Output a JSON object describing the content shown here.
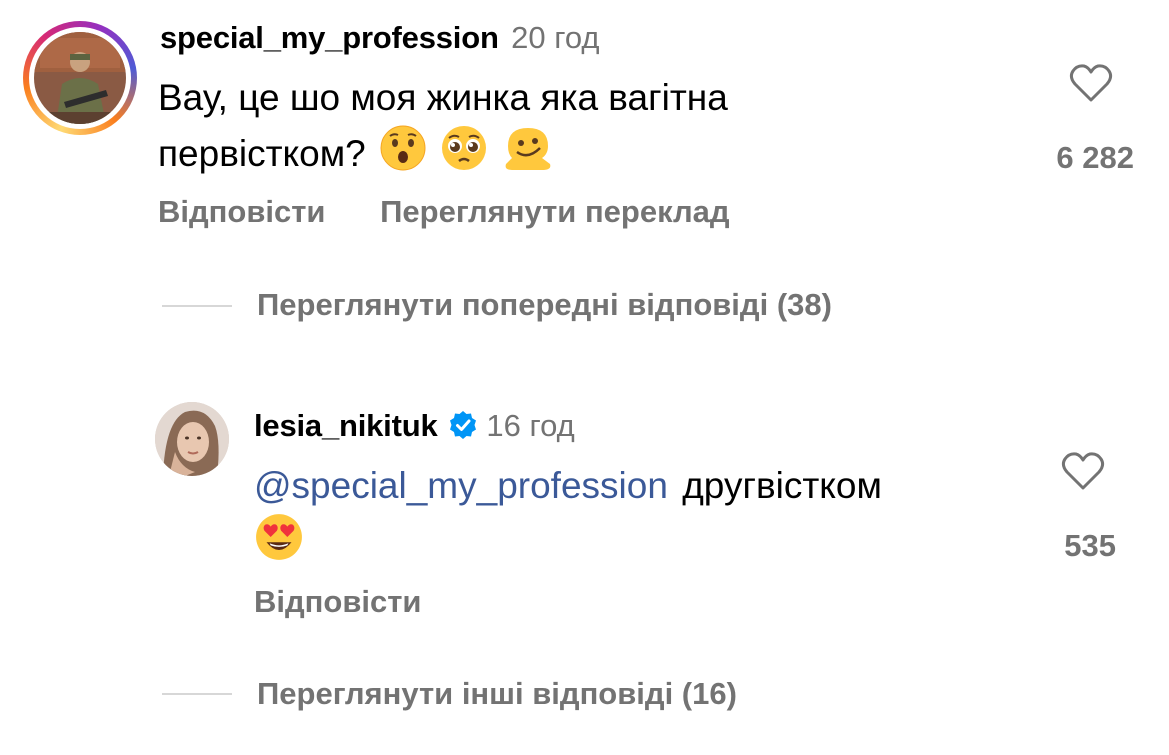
{
  "comments": [
    {
      "username": "special_my_profession",
      "time": "20 год",
      "text": "Вау, це шо моя жинка яка вагітна",
      "text_line2": "первістком?",
      "emojis": [
        "hushed-face-emoji",
        "pleading-face-emoji",
        "melting-face-emoji"
      ],
      "likes": "6 282",
      "reply_label": "Відповісти",
      "translate_label": "Переглянути переклад"
    },
    {
      "username": "lesia_nikituk",
      "verified": true,
      "time": "16 год",
      "mention": "@special_my_profession",
      "text": "другвістком",
      "emojis": [
        "heart-eyes-emoji"
      ],
      "likes": "535",
      "reply_label": "Відповісти"
    }
  ],
  "view_previous_replies": "Переглянути попередні відповіді (38)",
  "view_other_replies": "Переглянути інші відповіді (16)",
  "colors": {
    "verified_badge": "#0095f6",
    "mention": "#00376b",
    "secondary_text": "#737373"
  }
}
